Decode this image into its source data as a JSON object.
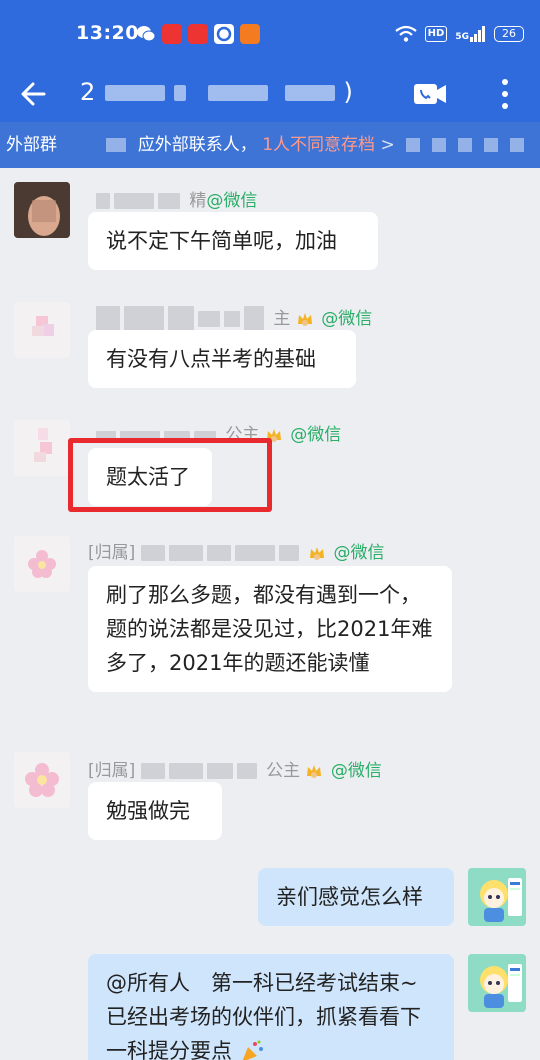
{
  "status_bar": {
    "time": "13:20",
    "hd_label": "HD",
    "signal_label": "5G",
    "battery": "26"
  },
  "header": {
    "title_visible": "2",
    "title_tail": ")",
    "accent_color": "#2f6bdc"
  },
  "notice": {
    "group_label": "外部群",
    "middle_text": "应外部联系人，",
    "warning_text": "1人不同意存档",
    "chevron": ">"
  },
  "messages": [
    {
      "side": "left",
      "sender_visible": "精",
      "suffix": "@微信",
      "has_crown": false,
      "text": "说不定下午简单呢，加油"
    },
    {
      "side": "left",
      "sender_visible": "主",
      "suffix": "@微信",
      "has_crown": true,
      "text": "有没有八点半考的基础"
    },
    {
      "side": "left",
      "sender_visible": "公主",
      "suffix": "@微信",
      "has_crown": true,
      "text": "题太活了"
    },
    {
      "side": "left",
      "sender_visible": "[归属]",
      "suffix": "@微信",
      "has_crown": true,
      "text": "刷了那么多题，都没有遇到一个，题的说法都是没见过，比2021年难多了，2021年的题还能读懂"
    },
    {
      "side": "left",
      "sender_visible": "[归属]",
      "sender_tail": "公主",
      "suffix": "@微信",
      "has_crown": true,
      "text": "勉强做完"
    },
    {
      "side": "right",
      "text": "亲们感觉怎么样"
    },
    {
      "side": "right",
      "text": "@所有人　第一科已经考试结束~已经出考场的伙伴们，抓紧看看下一科提分要点"
    }
  ]
}
